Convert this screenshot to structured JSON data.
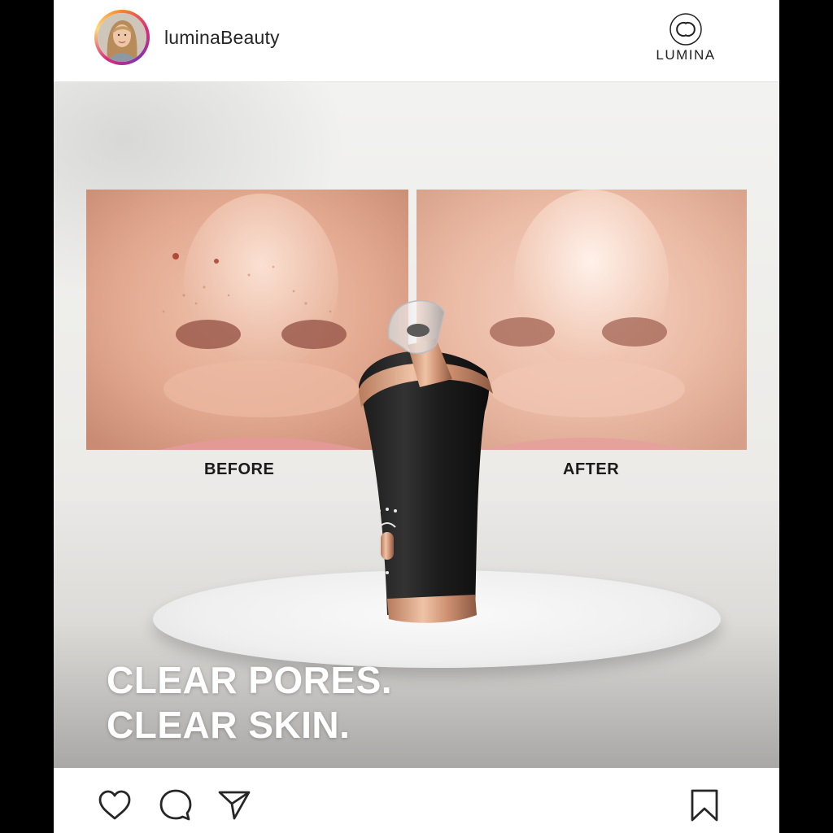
{
  "header": {
    "username": "luminaBeauty",
    "brand_name": "LUMINA",
    "avatar_icon": "profile-avatar",
    "brand_logo_icon": "interlocking-c-logo"
  },
  "post": {
    "before_label": "BEFORE",
    "after_label": "AFTER",
    "headline_line1": "CLEAR PORES.",
    "headline_line2": "CLEAR SKIN.",
    "product": "pore-vacuum-device",
    "accent_color": "#d19a7a"
  },
  "actions": {
    "like_icon": "heart-icon",
    "comment_icon": "comment-icon",
    "share_icon": "send-icon",
    "save_icon": "bookmark-icon"
  }
}
